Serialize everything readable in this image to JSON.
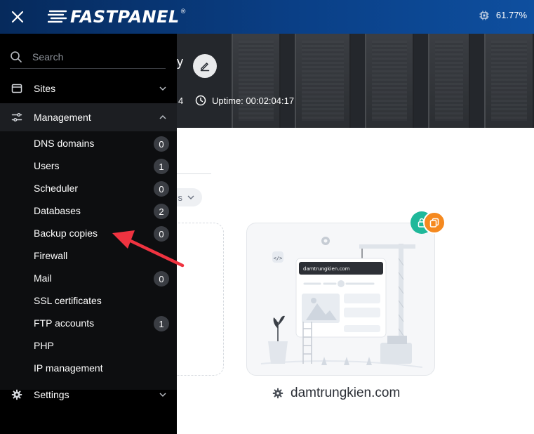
{
  "topbar": {
    "brand": "FASTPANEL",
    "brand_mark": "®",
    "cpu_usage": "61.77%"
  },
  "hero": {
    "partial_number": "4",
    "uptime": "Uptime: 00:02:04:17",
    "partial_title": "y"
  },
  "sidebar": {
    "search_placeholder": "Search",
    "sites_label": "Sites",
    "management_label": "Management",
    "settings_label": "Settings",
    "management_items": [
      {
        "label": "DNS domains",
        "count": "0"
      },
      {
        "label": "Users",
        "count": "1"
      },
      {
        "label": "Scheduler",
        "count": "0"
      },
      {
        "label": "Databases",
        "count": "2"
      },
      {
        "label": "Backup copies",
        "count": "0"
      },
      {
        "label": "Firewall",
        "count": ""
      },
      {
        "label": "Mail",
        "count": "0"
      },
      {
        "label": "SSL certificates",
        "count": ""
      },
      {
        "label": "FTP accounts",
        "count": "1"
      },
      {
        "label": "PHP",
        "count": ""
      },
      {
        "label": "IP management",
        "count": ""
      }
    ]
  },
  "main": {
    "filter_partial": "s",
    "site_card": {
      "browser_url": "damtrungkien.com",
      "site_name": "damtrungkien.com"
    }
  },
  "colors": {
    "topbar_start": "#062a5c",
    "topbar_end": "#0e4f9f",
    "sidebar_bg": "#000000",
    "badge_green": "#1fb89a",
    "badge_orange": "#f5891f",
    "arrow_red": "#ef3340"
  },
  "icons": {
    "close": "close-icon",
    "cpu": "cpu-chip-icon",
    "edit": "pencil-icon",
    "clock": "clock-icon",
    "search": "search-icon",
    "sites": "browser-window-icon",
    "management": "sliders-icon",
    "settings": "gear-icon"
  }
}
